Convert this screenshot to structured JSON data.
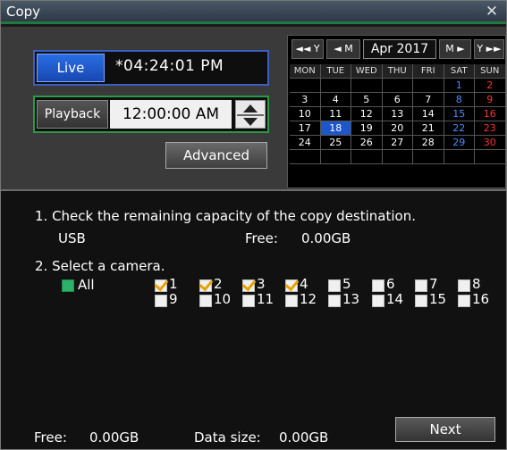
{
  "window": {
    "title": "Copy",
    "close_symbol": "✕"
  },
  "live": {
    "label": "Live",
    "time": "*04:24:01 PM"
  },
  "playback": {
    "label": "Playback",
    "time": "12:00:00 AM"
  },
  "advanced_label": "Advanced",
  "calendar": {
    "nav": {
      "prev_year": "◄◄ Y",
      "prev_month": "◄ M",
      "next_month": "M ►",
      "next_year": "Y ►►"
    },
    "month_label": "Apr 2017",
    "weekdays": [
      "MON",
      "TUE",
      "WED",
      "THU",
      "FRI",
      "SAT",
      "SUN"
    ],
    "weeks": [
      [
        "",
        "",
        "",
        "",
        "",
        "1",
        "2"
      ],
      [
        "3",
        "4",
        "5",
        "6",
        "7",
        "8",
        "9"
      ],
      [
        "10",
        "11",
        "12",
        "13",
        "14",
        "15",
        "16"
      ],
      [
        "17",
        "18",
        "19",
        "20",
        "21",
        "22",
        "23"
      ],
      [
        "24",
        "25",
        "26",
        "27",
        "28",
        "29",
        "30"
      ],
      [
        "",
        "",
        "",
        "",
        "",
        "",
        ""
      ]
    ],
    "selected_day": "18"
  },
  "step1": {
    "text": "1. Check the remaining capacity of the copy destination.",
    "device": "USB",
    "free_label": "Free:",
    "free_value": "0.00GB"
  },
  "step2": {
    "text": "2. Select a camera.",
    "all_label": "All"
  },
  "cameras": [
    {
      "label": "1",
      "checked": true
    },
    {
      "label": "2",
      "checked": true
    },
    {
      "label": "3",
      "checked": true
    },
    {
      "label": "4",
      "checked": true
    },
    {
      "label": "5",
      "checked": false
    },
    {
      "label": "6",
      "checked": false
    },
    {
      "label": "7",
      "checked": false
    },
    {
      "label": "8",
      "checked": false
    },
    {
      "label": "9",
      "checked": false
    },
    {
      "label": "10",
      "checked": false
    },
    {
      "label": "11",
      "checked": false
    },
    {
      "label": "12",
      "checked": false
    },
    {
      "label": "13",
      "checked": false
    },
    {
      "label": "14",
      "checked": false
    },
    {
      "label": "15",
      "checked": false
    },
    {
      "label": "16",
      "checked": false
    }
  ],
  "footer": {
    "free_label": "Free:",
    "free_value": "0.00GB",
    "data_size_label": "Data size:",
    "data_size_value": "0.00GB",
    "next_label": "Next"
  }
}
